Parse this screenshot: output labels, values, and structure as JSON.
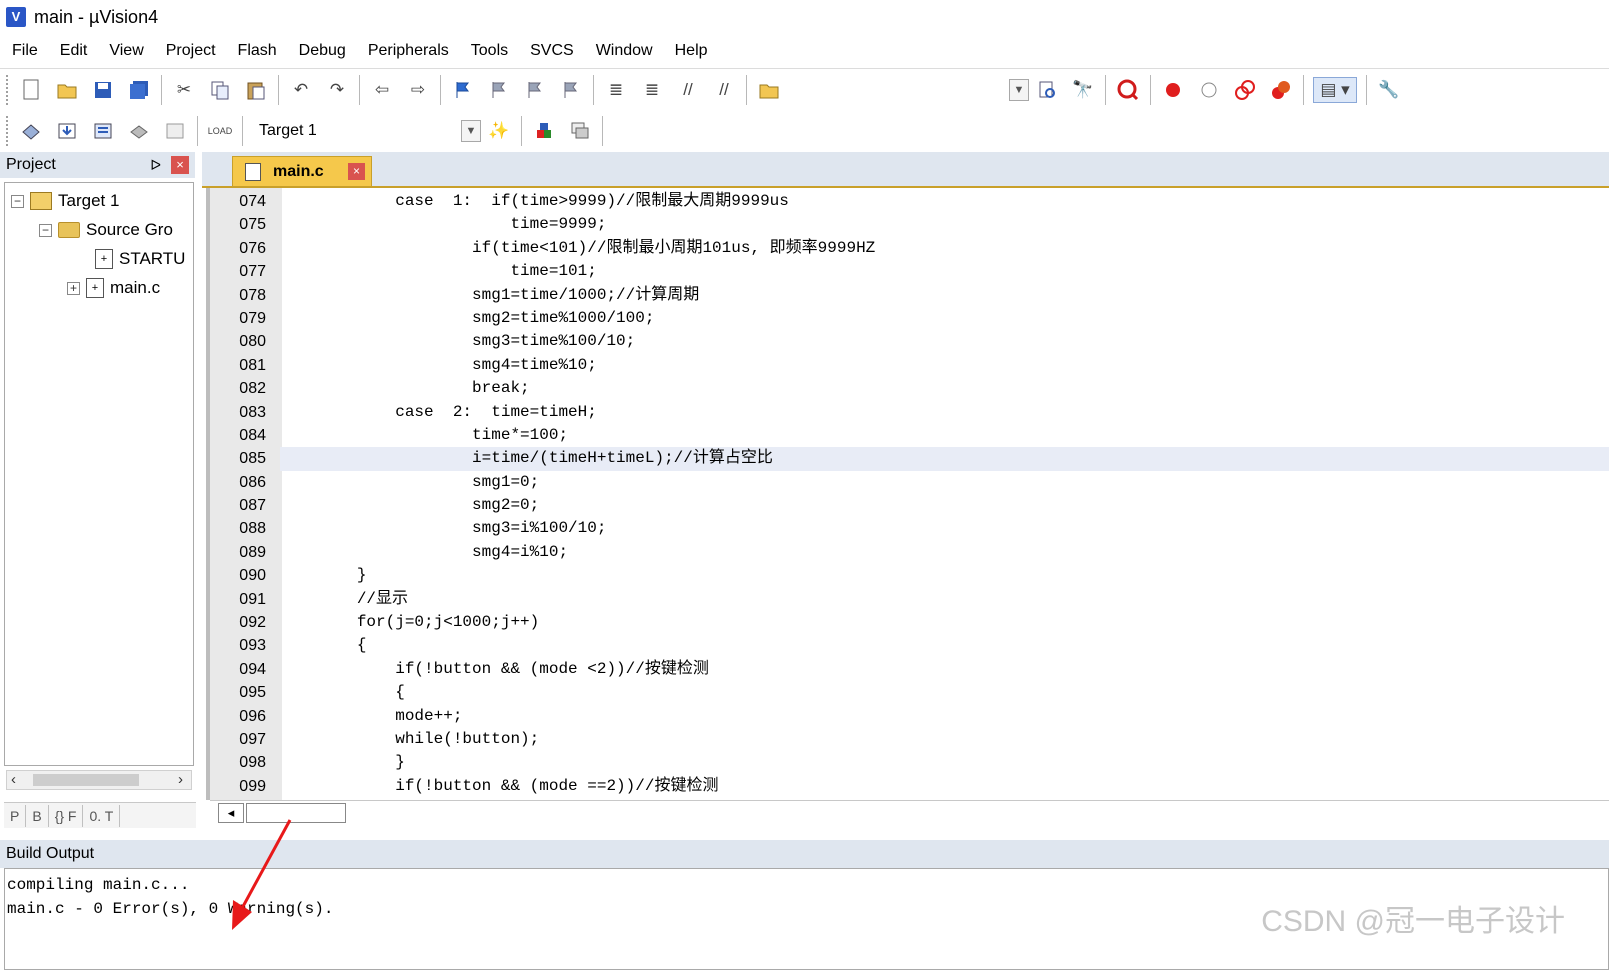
{
  "window": {
    "title": "main  - µVision4",
    "icon_letter": "V"
  },
  "menu": [
    "File",
    "Edit",
    "View",
    "Project",
    "Flash",
    "Debug",
    "Peripherals",
    "Tools",
    "SVCS",
    "Window",
    "Help"
  ],
  "toolbar2": {
    "target_value": "Target 1"
  },
  "project_panel": {
    "title": "Project",
    "pin_glyph": "ᐅ",
    "close_glyph": "×",
    "tree": [
      {
        "label": "Target 1",
        "expander": "−"
      },
      {
        "label": "Source Gro",
        "expander": "−"
      },
      {
        "label": "STARTU",
        "expander": ""
      },
      {
        "label": "main.c",
        "expander": "+"
      }
    ],
    "tabs": [
      "P",
      "B",
      "{} F",
      "0. T"
    ]
  },
  "editor": {
    "tab_label": "main.c",
    "highlighted_line": "085",
    "line_numbers": [
      "074",
      "075",
      "076",
      "077",
      "078",
      "079",
      "080",
      "081",
      "082",
      "083",
      "084",
      "085",
      "086",
      "087",
      "088",
      "089",
      "090",
      "091",
      "092",
      "093",
      "094",
      "095",
      "096",
      "097",
      "098",
      "099"
    ],
    "lines": [
      "            case  1:  if(time>9999)//限制最大周期9999us",
      "                        time=9999;",
      "                    if(time<101)//限制最小周期101us, 即频率9999HZ",
      "                        time=101;",
      "                    smg1=time/1000;//计算周期",
      "                    smg2=time%1000/100;",
      "                    smg3=time%100/10;",
      "                    smg4=time%10;",
      "                    break;",
      "            case  2:  time=timeH;",
      "                    time*=100;",
      "                    i=time/(timeH+timeL);//计算占空比",
      "                    smg1=0;",
      "                    smg2=0;",
      "                    smg3=i%100/10;",
      "                    smg4=i%10;",
      "        }",
      "        //显示",
      "        for(j=0;j<1000;j++)",
      "        {",
      "            if(!button && (mode <2))//按键检测",
      "            {",
      "            mode++;",
      "            while(!button);",
      "            }",
      "            if(!button && (mode ==2))//按键检测"
    ]
  },
  "build_output": {
    "title": "Build Output",
    "lines": [
      "compiling main.c...",
      "main.c - 0 Error(s), 0 Warning(s)."
    ]
  },
  "watermark": "CSDN @冠一电子设计",
  "colors": {
    "panel_header": "#dfe6ef",
    "tab_active": "#f5c84b",
    "annotation_arrow": "#e8191a",
    "line_highlight": "#e8ecf6"
  }
}
